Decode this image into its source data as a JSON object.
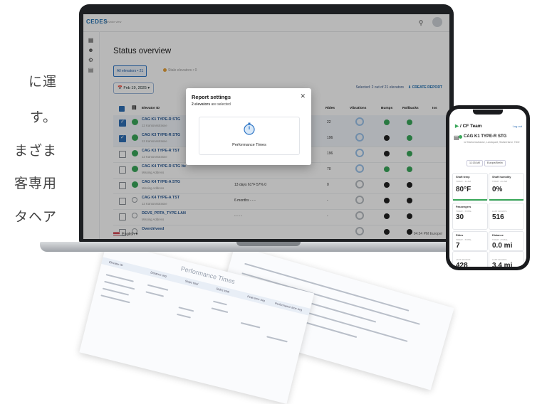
{
  "jp_fragments": [
    "に運",
    "す。",
    "まざま",
    "客専用",
    "タヘア"
  ],
  "app": {
    "logo": "CEDES",
    "logo_sub": "elevator view",
    "page_title": "Status overview",
    "tabs": [
      {
        "label": "All elevators • 21",
        "active": true
      },
      {
        "label": "Stale elevators • 0",
        "active": false
      }
    ],
    "date": "Feb 19, 2025",
    "selected_text": "Selected: 2 out of 21 elevators",
    "create_report": "CREATE REPORT",
    "columns": [
      "Elevator ID",
      "Rides",
      "Vibrations",
      "Bumps",
      "Rollbacks",
      "Iss"
    ],
    "rows": [
      {
        "name": "CAG K1 TYPE-R STG",
        "address": "12 Kantonsstrasse",
        "checked": true,
        "online": true,
        "extra": "",
        "rides": "22",
        "ring": "blue",
        "bump": "green",
        "roll": "green"
      },
      {
        "name": "CAG K3 TYPE-R STG",
        "address": "12 Kantonsstrasse",
        "checked": true,
        "online": true,
        "extra": "",
        "rides": "196",
        "ring": "blue",
        "bump": "black",
        "roll": "green"
      },
      {
        "name": "CAG K3 TYPE-R TST",
        "address": "12 Kantonsstrasse",
        "checked": false,
        "online": true,
        "extra": "",
        "rides": "196",
        "ring": "blue",
        "bump": "black",
        "roll": "green"
      },
      {
        "name": "CAG K4 TYPE-R STG lte",
        "address": "Missing Address",
        "checked": false,
        "online": true,
        "extra": "",
        "rides": "70",
        "ring": "blue",
        "bump": "green",
        "roll": "green"
      },
      {
        "name": "CAG K4 TYPE-A STG",
        "address": "Missing Address",
        "checked": false,
        "online": true,
        "extra": "13 days   61°F   57%   0",
        "rides": "0",
        "ring": "gray",
        "bump": "black",
        "roll": "black"
      },
      {
        "name": "CAG K4 TYPE-A TST",
        "address": "12 Kantonsstrasse",
        "checked": false,
        "online": false,
        "extra": "6 months   -   -   -",
        "rides": "-",
        "ring": "gray",
        "bump": "black",
        "roll": "black"
      },
      {
        "name": "DEVS_PRTA_TYPE-LAN",
        "address": "Missing Address",
        "checked": false,
        "online": false,
        "extra": "-   -   -   -",
        "rides": "-",
        "ring": "gray",
        "bump": "black",
        "roll": "black"
      },
      {
        "name": "Overdriveed",
        "address": "",
        "checked": false,
        "online": false,
        "extra": "",
        "rides": "",
        "ring": "gray",
        "bump": "black",
        "roll": "black"
      }
    ],
    "language": "English",
    "footer_time": "04:54 PM  Europe/"
  },
  "modal": {
    "title": "Report settings",
    "subtitle_bold": "2 elevators",
    "subtitle_rest": " are selected",
    "card_label": "Performance Times"
  },
  "phone": {
    "team": "/ CF Team",
    "logout": "Log out",
    "elevator": "CAG K1 TYPE-R STG",
    "address": "12 Kantonsstrasse, Landquart, Switzerland, 7302",
    "pills": [
      "11:15 AM",
      "Europe/Berlin"
    ],
    "boxes": [
      {
        "key": "Shaft temp",
        "sub": "TODAY • 11 AM",
        "value": "80°F"
      },
      {
        "key": "Shaft humidity",
        "sub": "TODAY • 11 AM",
        "value": "0%"
      },
      {
        "key": "Passengers",
        "sub": "TODAY • TOTAL",
        "value": "30"
      },
      {
        "key": "",
        "sub": "LAST 30 DAYS",
        "value": "516"
      },
      {
        "key": "Rides",
        "sub": "TODAY • TOTAL",
        "value": "7"
      },
      {
        "key": "Distance",
        "sub": "TODAY • TOTAL",
        "value": "0.0 mi"
      },
      {
        "key": "",
        "sub": "LAST 30 DAYS",
        "value": "428"
      },
      {
        "key": "",
        "sub": "LAST 30 DAYS",
        "value": "3.4 mi"
      }
    ]
  },
  "paper": {
    "heading": "Performance Times",
    "col_headers": [
      "Elevator ID",
      "Distance avg",
      "Stops total",
      "Rides total",
      "Peak time avg",
      "Performance time avg"
    ]
  }
}
